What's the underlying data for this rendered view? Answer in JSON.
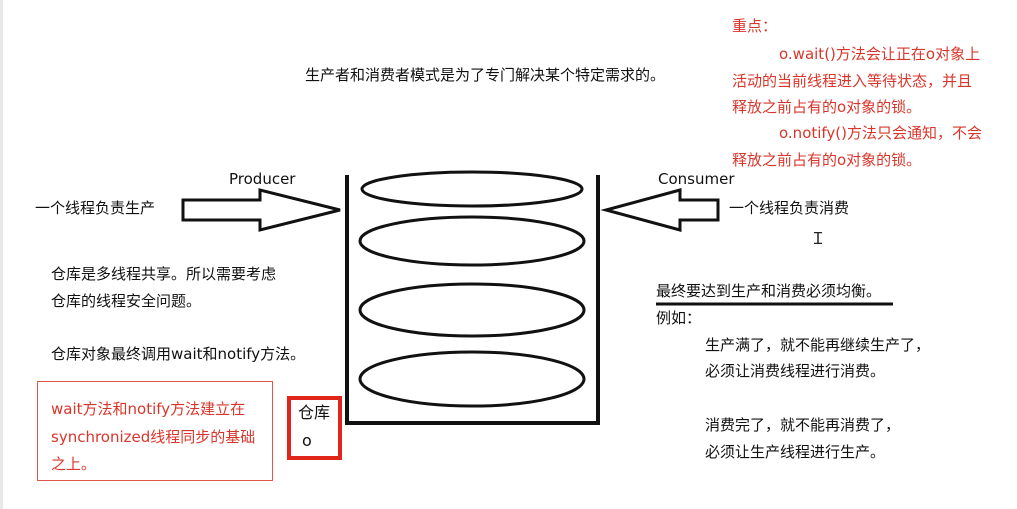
{
  "title": "生产者和消费者模式是为了专门解决某个特定需求的。",
  "producer_label": "Producer",
  "consumer_label": "Consumer",
  "producer_thread": "一个线程负责生产",
  "consumer_thread": "一个线程负责消费",
  "key_points": {
    "heading": "重点：",
    "wait_lines": [
      "o.wait()方法会让正在o对象上",
      "活动的当前线程进入等待状态，并且",
      "释放之前占有的o对象的锁。"
    ],
    "notify_lines": [
      "o.notify()方法只会通知，不会",
      "释放之前占有的o对象的锁。"
    ]
  },
  "warehouse_notes": {
    "line1": "仓库是多线程共享。所以需要考虑",
    "line2": "仓库的线程安全问题。",
    "line3": "仓库对象最终调用wait和notify方法。"
  },
  "sync_note": [
    "wait方法和notify方法建立在",
    "synchronized线程同步的基础",
    "之上。"
  ],
  "warehouse_box": {
    "line1": "仓库",
    "line2": "o"
  },
  "balance": {
    "heading": "最终要达到生产和消费必须均衡。",
    "example": "例如：",
    "full_lines": [
      "生产满了，就不能再继续生产了，",
      "必须让消费线程进行消费。"
    ],
    "empty_lines": [
      "消费完了，就不能再消费了，",
      "必须让生产线程进行生产。"
    ]
  },
  "colors": {
    "accent_red": "#d9362b",
    "ink": "#111111"
  }
}
